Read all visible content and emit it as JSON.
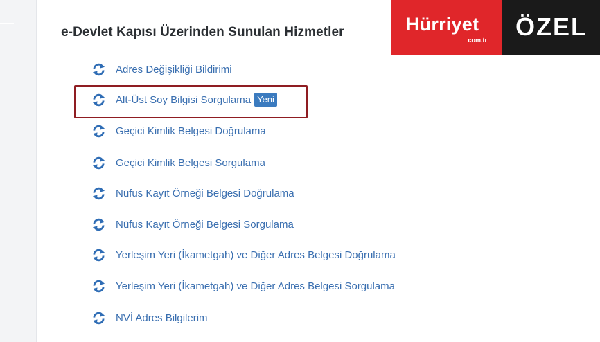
{
  "section": {
    "title": "e-Devlet Kapısı Üzerinden Sunulan Hizmetler"
  },
  "services": [
    {
      "label": "Adres Değişikliği Bildirimi",
      "icon": "refresh-icon"
    },
    {
      "label": "Alt-Üst Soy Bilgisi Sorgulama",
      "icon": "refresh-icon",
      "badge": "Yeni"
    },
    {
      "label": "Geçici Kimlik Belgesi Doğrulama",
      "icon": "refresh-icon"
    },
    {
      "label": "Geçici Kimlik Belgesi Sorgulama",
      "icon": "refresh-icon"
    },
    {
      "label": "Nüfus Kayıt Örneği Belgesi Doğrulama",
      "icon": "refresh-icon"
    },
    {
      "label": "Nüfus Kayıt Örneği Belgesi Sorgulama",
      "icon": "refresh-icon"
    },
    {
      "label": "Yerleşim Yeri (İkametgah) ve Diğer Adres Belgesi Doğrulama",
      "icon": "refresh-icon"
    },
    {
      "label": "Yerleşim Yeri (İkametgah) ve Diğer Adres Belgesi Sorgulama",
      "icon": "refresh-icon"
    },
    {
      "label": "NVİ Adres Bilgilerim",
      "icon": "refresh-icon"
    }
  ],
  "watermark": {
    "brand": "Hürriyet",
    "brand_sub": "com.tr",
    "tag": "ÖZEL"
  },
  "colors": {
    "link": "#3a6fb0",
    "icon": "#2f6db5",
    "badge": "#3b7bbf",
    "highlight": "#8f1d22",
    "brand_red": "#e0262a",
    "brand_black": "#1a1a1a"
  }
}
